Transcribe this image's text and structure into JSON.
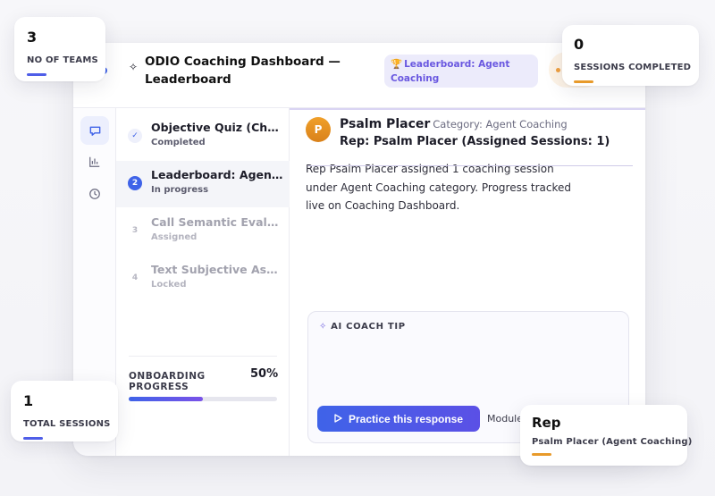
{
  "header": {
    "title": "ODIO Coaching Dashboard — Leaderboard",
    "badge": "Leaderboard: Agent Coaching",
    "trophy_icon": "🏆"
  },
  "rail": {
    "icons": [
      "chat-icon",
      "bar-chart-icon",
      "clock-icon"
    ]
  },
  "steps": [
    {
      "num": "✓",
      "title": "Objective Quiz (Cho...",
      "status": "Completed",
      "state": "done"
    },
    {
      "num": "2",
      "title": "Leaderboard: Agent...",
      "status": "In progress",
      "state": "active"
    },
    {
      "num": "3",
      "title": "Call Semantic Evalu...",
      "status": "Assigned",
      "state": "muted"
    },
    {
      "num": "4",
      "title": "Text Subjective Ass...",
      "status": "Locked",
      "state": "muted"
    }
  ],
  "progress": {
    "label": "ONBOARDING PROGRESS",
    "percent_text": "50%",
    "fraction": 0.5
  },
  "rep": {
    "initial": "P",
    "name": "Psalm Placer",
    "category": "Category: Agent Coaching",
    "line": "Rep: Psalm Placer (Assigned Sessions: 1)",
    "summary": "Rep Psalm Placer assigned 1 coaching session under Agent Coaching category. Progress tracked live on Coaching Dashboard."
  },
  "tip": {
    "heading": "AI COACH TIP",
    "button": "Practice this response",
    "module": "Module"
  },
  "stats": {
    "teams": {
      "value": "3",
      "label": "NO OF TEAMS",
      "color": "#4f5ee8"
    },
    "sessions_completed": {
      "value": "0",
      "label": "SESSIONS COMPLETED",
      "color": "#e89a2a"
    },
    "total_sessions": {
      "value": "1",
      "label": "TOTAL SESSIONS",
      "color": "#4f5ee8"
    },
    "rep_card": {
      "value": "Rep",
      "label": "Psalm Placer (Agent Coaching)",
      "color": "#e89a2a"
    }
  },
  "colors": {
    "accent": "#3f63e8",
    "accent_purple": "#6a58e0",
    "orange": "#e89a2a"
  }
}
